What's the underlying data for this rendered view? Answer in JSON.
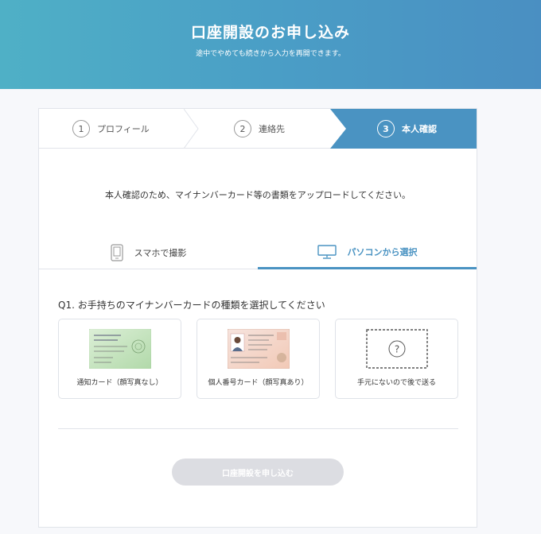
{
  "hero": {
    "title": "口座開設のお申し込み",
    "subtitle": "途中でやめても続きから入力を再開できます。"
  },
  "stepper": {
    "steps": [
      {
        "number": "1",
        "label": "プロフィール"
      },
      {
        "number": "2",
        "label": "連絡先"
      },
      {
        "number": "3",
        "label": "本人確認"
      }
    ],
    "active_color": "#4a93c2"
  },
  "intro_text": "本人確認のため、マイナンバーカード等の書類をアップロードしてください。",
  "tabs": {
    "phone": {
      "label": "スマホで撮影",
      "icon": "smartphone-icon"
    },
    "pc": {
      "label": "パソコンから選択",
      "icon": "monitor-icon"
    }
  },
  "question": "Q1. お手持ちのマイナンバーカードの種類を選択してください",
  "options": [
    {
      "label": "通知カード（顔写真なし）",
      "icon": "notification-card-image"
    },
    {
      "label": "個人番号カード（顔写真あり）",
      "icon": "mynumber-card-image"
    },
    {
      "label": "手元にないので後で送る",
      "icon": "question-icon"
    }
  ],
  "submit_label": "口座開設を申し込む"
}
